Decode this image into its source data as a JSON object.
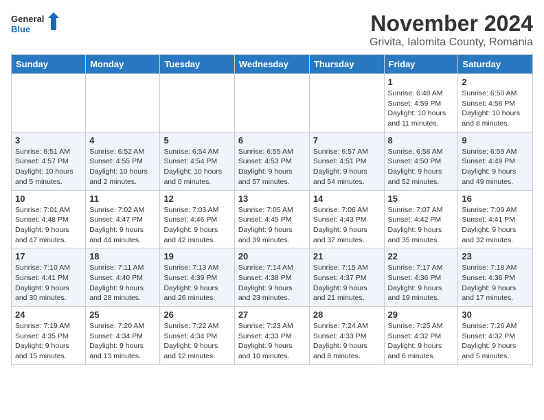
{
  "header": {
    "logo_general": "General",
    "logo_blue": "Blue",
    "month": "November 2024",
    "location": "Grivita, Ialomita County, Romania"
  },
  "weekdays": [
    "Sunday",
    "Monday",
    "Tuesday",
    "Wednesday",
    "Thursday",
    "Friday",
    "Saturday"
  ],
  "weeks": [
    [
      {
        "day": "",
        "info": ""
      },
      {
        "day": "",
        "info": ""
      },
      {
        "day": "",
        "info": ""
      },
      {
        "day": "",
        "info": ""
      },
      {
        "day": "",
        "info": ""
      },
      {
        "day": "1",
        "info": "Sunrise: 6:48 AM\nSunset: 4:59 PM\nDaylight: 10 hours and 11 minutes."
      },
      {
        "day": "2",
        "info": "Sunrise: 6:50 AM\nSunset: 4:58 PM\nDaylight: 10 hours and 8 minutes."
      }
    ],
    [
      {
        "day": "3",
        "info": "Sunrise: 6:51 AM\nSunset: 4:57 PM\nDaylight: 10 hours and 5 minutes."
      },
      {
        "day": "4",
        "info": "Sunrise: 6:52 AM\nSunset: 4:55 PM\nDaylight: 10 hours and 2 minutes."
      },
      {
        "day": "5",
        "info": "Sunrise: 6:54 AM\nSunset: 4:54 PM\nDaylight: 10 hours and 0 minutes."
      },
      {
        "day": "6",
        "info": "Sunrise: 6:55 AM\nSunset: 4:53 PM\nDaylight: 9 hours and 57 minutes."
      },
      {
        "day": "7",
        "info": "Sunrise: 6:57 AM\nSunset: 4:51 PM\nDaylight: 9 hours and 54 minutes."
      },
      {
        "day": "8",
        "info": "Sunrise: 6:58 AM\nSunset: 4:50 PM\nDaylight: 9 hours and 52 minutes."
      },
      {
        "day": "9",
        "info": "Sunrise: 6:59 AM\nSunset: 4:49 PM\nDaylight: 9 hours and 49 minutes."
      }
    ],
    [
      {
        "day": "10",
        "info": "Sunrise: 7:01 AM\nSunset: 4:48 PM\nDaylight: 9 hours and 47 minutes."
      },
      {
        "day": "11",
        "info": "Sunrise: 7:02 AM\nSunset: 4:47 PM\nDaylight: 9 hours and 44 minutes."
      },
      {
        "day": "12",
        "info": "Sunrise: 7:03 AM\nSunset: 4:46 PM\nDaylight: 9 hours and 42 minutes."
      },
      {
        "day": "13",
        "info": "Sunrise: 7:05 AM\nSunset: 4:45 PM\nDaylight: 9 hours and 39 minutes."
      },
      {
        "day": "14",
        "info": "Sunrise: 7:06 AM\nSunset: 4:43 PM\nDaylight: 9 hours and 37 minutes."
      },
      {
        "day": "15",
        "info": "Sunrise: 7:07 AM\nSunset: 4:42 PM\nDaylight: 9 hours and 35 minutes."
      },
      {
        "day": "16",
        "info": "Sunrise: 7:09 AM\nSunset: 4:41 PM\nDaylight: 9 hours and 32 minutes."
      }
    ],
    [
      {
        "day": "17",
        "info": "Sunrise: 7:10 AM\nSunset: 4:41 PM\nDaylight: 9 hours and 30 minutes."
      },
      {
        "day": "18",
        "info": "Sunrise: 7:11 AM\nSunset: 4:40 PM\nDaylight: 9 hours and 28 minutes."
      },
      {
        "day": "19",
        "info": "Sunrise: 7:13 AM\nSunset: 4:39 PM\nDaylight: 9 hours and 26 minutes."
      },
      {
        "day": "20",
        "info": "Sunrise: 7:14 AM\nSunset: 4:38 PM\nDaylight: 9 hours and 23 minutes."
      },
      {
        "day": "21",
        "info": "Sunrise: 7:15 AM\nSunset: 4:37 PM\nDaylight: 9 hours and 21 minutes."
      },
      {
        "day": "22",
        "info": "Sunrise: 7:17 AM\nSunset: 4:36 PM\nDaylight: 9 hours and 19 minutes."
      },
      {
        "day": "23",
        "info": "Sunrise: 7:18 AM\nSunset: 4:36 PM\nDaylight: 9 hours and 17 minutes."
      }
    ],
    [
      {
        "day": "24",
        "info": "Sunrise: 7:19 AM\nSunset: 4:35 PM\nDaylight: 9 hours and 15 minutes."
      },
      {
        "day": "25",
        "info": "Sunrise: 7:20 AM\nSunset: 4:34 PM\nDaylight: 9 hours and 13 minutes."
      },
      {
        "day": "26",
        "info": "Sunrise: 7:22 AM\nSunset: 4:34 PM\nDaylight: 9 hours and 12 minutes."
      },
      {
        "day": "27",
        "info": "Sunrise: 7:23 AM\nSunset: 4:33 PM\nDaylight: 9 hours and 10 minutes."
      },
      {
        "day": "28",
        "info": "Sunrise: 7:24 AM\nSunset: 4:33 PM\nDaylight: 9 hours and 8 minutes."
      },
      {
        "day": "29",
        "info": "Sunrise: 7:25 AM\nSunset: 4:32 PM\nDaylight: 9 hours and 6 minutes."
      },
      {
        "day": "30",
        "info": "Sunrise: 7:26 AM\nSunset: 4:32 PM\nDaylight: 9 hours and 5 minutes."
      }
    ]
  ]
}
